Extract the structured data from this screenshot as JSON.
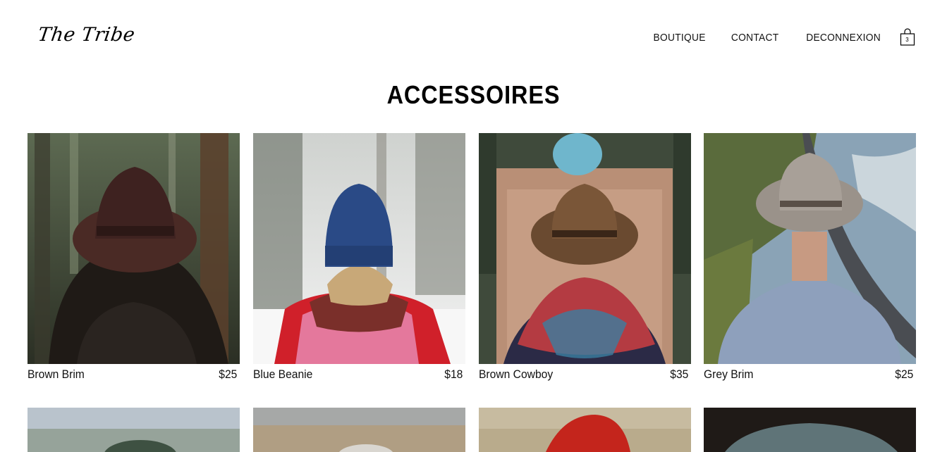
{
  "header": {
    "logo": "The Tribe",
    "nav": [
      {
        "label": "BOUTIQUE"
      },
      {
        "label": "CONTACT"
      },
      {
        "label": "DECONNEXION"
      }
    ],
    "cart": {
      "icon": "shopping-bag-icon",
      "count": "3"
    }
  },
  "main": {
    "title": "ACCESSOIRES",
    "products": [
      {
        "name": "Brown Brim",
        "price": "$25"
      },
      {
        "name": "Blue Beanie",
        "price": "$18"
      },
      {
        "name": "Brown Cowboy",
        "price": "$35"
      },
      {
        "name": "Grey Brim",
        "price": "$25"
      }
    ]
  }
}
